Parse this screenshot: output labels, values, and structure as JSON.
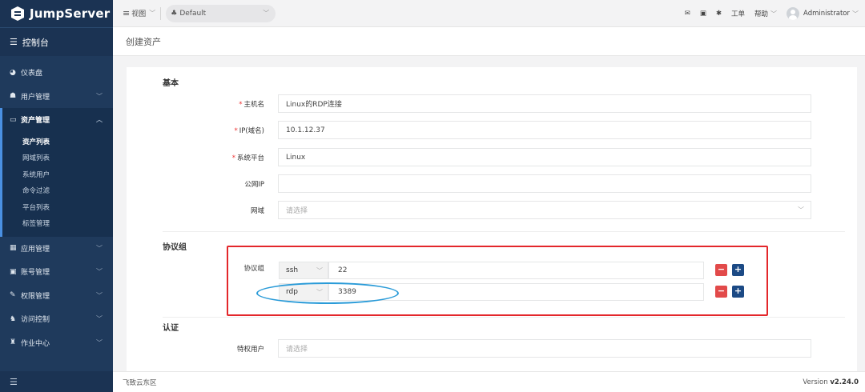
{
  "brand": {
    "name": "JumpServer"
  },
  "sidebar": {
    "console": "控制台",
    "items": [
      {
        "label": "仪表盘",
        "icon": "dashboard-icon"
      },
      {
        "label": "用户管理",
        "icon": "users-icon"
      },
      {
        "label": "资产管理",
        "icon": "assets-icon"
      },
      {
        "label": "应用管理",
        "icon": "apps-icon"
      },
      {
        "label": "账号管理",
        "icon": "account-icon"
      },
      {
        "label": "权限管理",
        "icon": "permission-icon"
      },
      {
        "label": "访问控制",
        "icon": "access-control-icon"
      },
      {
        "label": "作业中心",
        "icon": "job-center-icon"
      }
    ],
    "asset_subitems": [
      "资产列表",
      "网域列表",
      "系统用户",
      "命令过滤",
      "平台列表",
      "标签管理"
    ]
  },
  "header": {
    "view_label": "视图",
    "org": "Default",
    "ticket": "工单",
    "help": "帮助",
    "user": "Administrator"
  },
  "page": {
    "title": "创建资产",
    "sections": {
      "basic": "基本",
      "protocols": "协议组",
      "auth": "认证"
    },
    "fields": {
      "hostname": {
        "label": "主机名",
        "value": "Linux的RDP连接"
      },
      "ip": {
        "label": "IP(域名)",
        "value": "10.1.12.37"
      },
      "platform": {
        "label": "系统平台",
        "value": "Linux"
      },
      "public_ip": {
        "label": "公网IP",
        "value": ""
      },
      "domain": {
        "label": "网域",
        "placeholder": "请选择"
      },
      "protocols": {
        "label": "协议组",
        "rows": [
          {
            "protocol": "ssh",
            "port": "22"
          },
          {
            "protocol": "rdp",
            "port": "3389"
          }
        ]
      },
      "admin_user": {
        "label": "特权用户",
        "placeholder": "请选择"
      }
    }
  },
  "footer": {
    "left": "飞致云东区",
    "version_prefix": "Version",
    "version": "v2.24.0"
  },
  "colors": {
    "sidebar": "#1f3a5c",
    "annotation_box": "#e3272b",
    "annotation_ellipse": "#2a9bd8",
    "remove_button": "#e24a4a",
    "add_button": "#1c4a85"
  }
}
